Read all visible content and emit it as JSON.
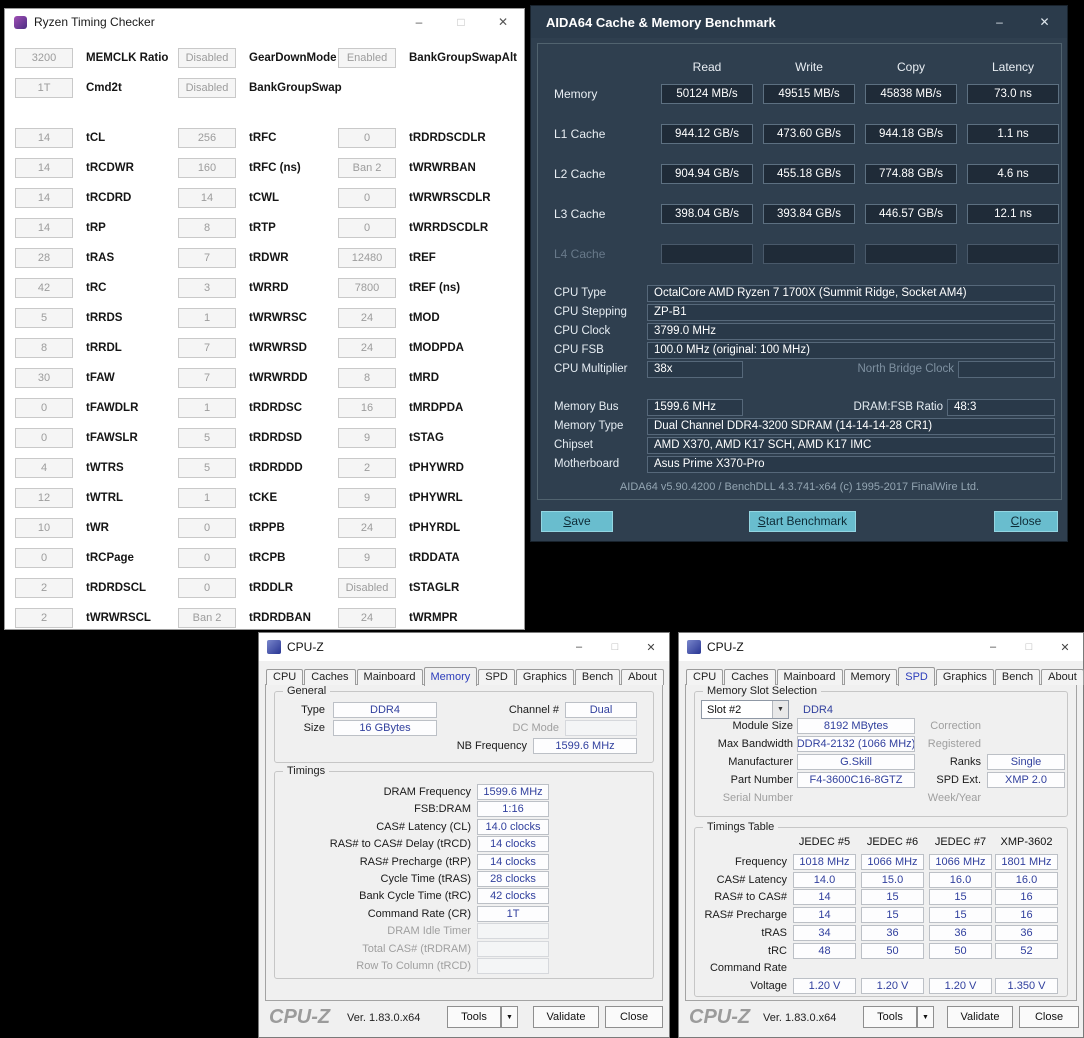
{
  "chrome": {
    "minimize": "–",
    "maximize": "□",
    "close": "✕",
    "dropdown_arrow": "▼"
  },
  "rtc": {
    "title": "Ryzen Timing Checker",
    "top_rows": [
      [
        {
          "value": "3200",
          "label": "MEMCLK Ratio"
        },
        {
          "value": "Disabled",
          "label": "GearDownMode"
        },
        {
          "value": "Enabled",
          "label": "BankGroupSwapAlt"
        }
      ],
      [
        {
          "value": "1T",
          "label": "Cmd2t"
        },
        {
          "value": "Disabled",
          "label": "BankGroupSwap"
        },
        null
      ]
    ],
    "rows": [
      [
        {
          "value": "14",
          "label": "tCL"
        },
        {
          "value": "256",
          "label": "tRFC"
        },
        {
          "value": "0",
          "label": "tRDRDSCDLR"
        }
      ],
      [
        {
          "value": "14",
          "label": "tRCDWR"
        },
        {
          "value": "160",
          "label": "tRFC (ns)"
        },
        {
          "value": "Ban 2",
          "label": "tWRWRBAN"
        }
      ],
      [
        {
          "value": "14",
          "label": "tRCDRD"
        },
        {
          "value": "14",
          "label": "tCWL"
        },
        {
          "value": "0",
          "label": "tWRWRSCDLR"
        }
      ],
      [
        {
          "value": "14",
          "label": "tRP"
        },
        {
          "value": "8",
          "label": "tRTP"
        },
        {
          "value": "0",
          "label": "tWRRDSCDLR"
        }
      ],
      [
        {
          "value": "28",
          "label": "tRAS"
        },
        {
          "value": "7",
          "label": "tRDWR"
        },
        {
          "value": "12480",
          "label": "tREF"
        }
      ],
      [
        {
          "value": "42",
          "label": "tRC"
        },
        {
          "value": "3",
          "label": "tWRRD"
        },
        {
          "value": "7800",
          "label": "tREF (ns)"
        }
      ],
      [
        {
          "value": "5",
          "label": "tRRDS"
        },
        {
          "value": "1",
          "label": "tWRWRSC"
        },
        {
          "value": "24",
          "label": "tMOD"
        }
      ],
      [
        {
          "value": "8",
          "label": "tRRDL"
        },
        {
          "value": "7",
          "label": "tWRWRSD"
        },
        {
          "value": "24",
          "label": "tMODPDA"
        }
      ],
      [
        {
          "value": "30",
          "label": "tFAW"
        },
        {
          "value": "7",
          "label": "tWRWRDD"
        },
        {
          "value": "8",
          "label": "tMRD"
        }
      ],
      [
        {
          "value": "0",
          "label": "tFAWDLR"
        },
        {
          "value": "1",
          "label": "tRDRDSC"
        },
        {
          "value": "16",
          "label": "tMRDPDA"
        }
      ],
      [
        {
          "value": "0",
          "label": "tFAWSLR"
        },
        {
          "value": "5",
          "label": "tRDRDSD"
        },
        {
          "value": "9",
          "label": "tSTAG"
        }
      ],
      [
        {
          "value": "4",
          "label": "tWTRS"
        },
        {
          "value": "5",
          "label": "tRDRDDD"
        },
        {
          "value": "2",
          "label": "tPHYWRD"
        }
      ],
      [
        {
          "value": "12",
          "label": "tWTRL"
        },
        {
          "value": "1",
          "label": "tCKE"
        },
        {
          "value": "9",
          "label": "tPHYWRL"
        }
      ],
      [
        {
          "value": "10",
          "label": "tWR"
        },
        {
          "value": "0",
          "label": "tRPPB"
        },
        {
          "value": "24",
          "label": "tPHYRDL"
        }
      ],
      [
        {
          "value": "0",
          "label": "tRCPage"
        },
        {
          "value": "0",
          "label": "tRCPB"
        },
        {
          "value": "9",
          "label": "tRDDATA"
        }
      ],
      [
        {
          "value": "2",
          "label": "tRDRDSCL"
        },
        {
          "value": "0",
          "label": "tRDDLR"
        },
        {
          "value": "Disabled",
          "label": "tSTAGLR"
        }
      ],
      [
        {
          "value": "2",
          "label": "tWRWRSCL"
        },
        {
          "value": "Ban 2",
          "label": "tRDRDBAN"
        },
        {
          "value": "24",
          "label": "tWRMPR"
        }
      ]
    ]
  },
  "aida": {
    "title": "AIDA64 Cache & Memory Benchmark",
    "columns": [
      "Read",
      "Write",
      "Copy",
      "Latency"
    ],
    "bench_rows": [
      {
        "label": "Memory",
        "values": [
          "50124 MB/s",
          "49515 MB/s",
          "45838 MB/s",
          "73.0 ns"
        ],
        "disabled": false
      },
      {
        "label": "L1 Cache",
        "values": [
          "944.12 GB/s",
          "473.60 GB/s",
          "944.18 GB/s",
          "1.1 ns"
        ],
        "disabled": false
      },
      {
        "label": "L2 Cache",
        "values": [
          "904.94 GB/s",
          "455.18 GB/s",
          "774.88 GB/s",
          "4.6 ns"
        ],
        "disabled": false
      },
      {
        "label": "L3 Cache",
        "values": [
          "398.04 GB/s",
          "393.84 GB/s",
          "446.57 GB/s",
          "12.1 ns"
        ],
        "disabled": false
      },
      {
        "label": "L4 Cache",
        "values": [
          "",
          "",
          "",
          ""
        ],
        "disabled": true
      }
    ],
    "info_rows": [
      {
        "label": "CPU Type",
        "value": "OctalCore AMD Ryzen 7 1700X  (Summit Ridge, Socket AM4)"
      },
      {
        "label": "CPU Stepping",
        "value": "ZP-B1"
      },
      {
        "label": "CPU Clock",
        "value": "3799.0 MHz"
      },
      {
        "label": "CPU FSB",
        "value": "100.0 MHz  (original: 100 MHz)"
      }
    ],
    "cpu_multiplier": {
      "label": "CPU Multiplier",
      "value": "38x",
      "label2": "North Bridge Clock",
      "value2": ""
    },
    "memory_bus": {
      "label": "Memory Bus",
      "value": "1599.6 MHz",
      "label2": "DRAM:FSB Ratio",
      "value2": "48:3"
    },
    "info_rows2": [
      {
        "label": "Memory Type",
        "value": "Dual Channel DDR4-3200 SDRAM  (14-14-14-28 CR1)"
      },
      {
        "label": "Chipset",
        "value": "AMD X370, AMD K17 SCH, AMD K17 IMC"
      },
      {
        "label": "Motherboard",
        "value": "Asus Prime X370-Pro"
      }
    ],
    "footnote": "AIDA64 v5.90.4200 / BenchDLL 4.3.741-x64  (c) 1995-2017 FinalWire Ltd.",
    "buttons": {
      "save": "Save",
      "start": "Start Benchmark",
      "close": "Close"
    }
  },
  "cpuz_common": {
    "title": "CPU-Z",
    "tabs": [
      "CPU",
      "Caches",
      "Mainboard",
      "Memory",
      "SPD",
      "Graphics",
      "Bench",
      "About"
    ],
    "logo": "CPU-Z",
    "version": "Ver. 1.83.0.x64",
    "tools_label": "Tools",
    "validate_label": "Validate",
    "close_label": "Close"
  },
  "cpuz_mem": {
    "active_tab": "Memory",
    "general": {
      "legend": "General",
      "type_label": "Type",
      "type": "DDR4",
      "channel_label": "Channel #",
      "channel": "Dual",
      "size_label": "Size",
      "size": "16 GBytes",
      "dc_label": "DC Mode",
      "dc": "",
      "nb_label": "NB Frequency",
      "nb": "1599.6 MHz"
    },
    "timings": {
      "legend": "Timings",
      "rows": [
        {
          "label": "DRAM Frequency",
          "value": "1599.6 MHz",
          "disabled": false
        },
        {
          "label": "FSB:DRAM",
          "value": "1:16",
          "disabled": false
        },
        {
          "label": "CAS# Latency (CL)",
          "value": "14.0 clocks",
          "disabled": false
        },
        {
          "label": "RAS# to CAS# Delay (tRCD)",
          "value": "14 clocks",
          "disabled": false
        },
        {
          "label": "RAS# Precharge (tRP)",
          "value": "14 clocks",
          "disabled": false
        },
        {
          "label": "Cycle Time (tRAS)",
          "value": "28 clocks",
          "disabled": false
        },
        {
          "label": "Bank Cycle Time (tRC)",
          "value": "42 clocks",
          "disabled": false
        },
        {
          "label": "Command Rate (CR)",
          "value": "1T",
          "disabled": false
        },
        {
          "label": "DRAM Idle Timer",
          "value": "",
          "disabled": true
        },
        {
          "label": "Total CAS# (tRDRAM)",
          "value": "",
          "disabled": true
        },
        {
          "label": "Row To Column (tRCD)",
          "value": "",
          "disabled": true
        }
      ]
    }
  },
  "cpuz_spd": {
    "active_tab": "SPD",
    "slot": {
      "legend": "Memory Slot Selection",
      "slot_value": "Slot #2",
      "ddr_label": "DDR4",
      "rows": [
        {
          "label": "Module Size",
          "value": "8192 MBytes",
          "label_dim": false,
          "label2": "Correction",
          "value2": "",
          "label2_dim": true
        },
        {
          "label": "Max Bandwidth",
          "value": "DDR4-2132 (1066 MHz)",
          "label_dim": false,
          "label2": "Registered",
          "value2": "",
          "label2_dim": true
        },
        {
          "label": "Manufacturer",
          "value": "G.Skill",
          "label_dim": false,
          "label2": "Ranks",
          "value2": "Single",
          "label2_dim": false
        },
        {
          "label": "Part Number",
          "value": "F4-3600C16-8GTZ",
          "label_dim": false,
          "label2": "SPD Ext.",
          "value2": "XMP 2.0",
          "label2_dim": false
        },
        {
          "label": "Serial Number",
          "value": "",
          "label_dim": true,
          "label2": "Week/Year",
          "value2": "",
          "label2_dim": true
        }
      ]
    },
    "timings_table": {
      "legend": "Timings Table",
      "columns": [
        "JEDEC #5",
        "JEDEC #6",
        "JEDEC #7",
        "XMP-3602"
      ],
      "rows": [
        {
          "label": "Frequency",
          "values": [
            "1018 MHz",
            "1066 MHz",
            "1066 MHz",
            "1801 MHz"
          ]
        },
        {
          "label": "CAS# Latency",
          "values": [
            "14.0",
            "15.0",
            "16.0",
            "16.0"
          ]
        },
        {
          "label": "RAS# to CAS#",
          "values": [
            "14",
            "15",
            "15",
            "16"
          ]
        },
        {
          "label": "RAS# Precharge",
          "values": [
            "14",
            "15",
            "15",
            "16"
          ]
        },
        {
          "label": "tRAS",
          "values": [
            "34",
            "36",
            "36",
            "36"
          ]
        },
        {
          "label": "tRC",
          "values": [
            "48",
            "50",
            "50",
            "52"
          ]
        },
        {
          "label": "Command Rate",
          "values": [
            "",
            "",
            "",
            ""
          ]
        },
        {
          "label": "Voltage",
          "values": [
            "1.20 V",
            "1.20 V",
            "1.20 V",
            "1.350 V"
          ]
        }
      ]
    }
  }
}
